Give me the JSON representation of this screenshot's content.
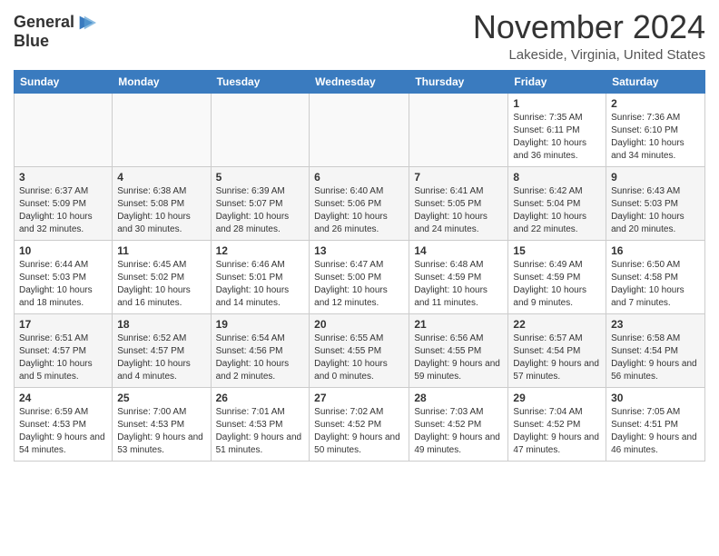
{
  "header": {
    "logo_line1": "General",
    "logo_line2": "Blue",
    "month": "November 2024",
    "location": "Lakeside, Virginia, United States"
  },
  "days_of_week": [
    "Sunday",
    "Monday",
    "Tuesday",
    "Wednesday",
    "Thursday",
    "Friday",
    "Saturday"
  ],
  "weeks": [
    [
      {
        "num": "",
        "detail": ""
      },
      {
        "num": "",
        "detail": ""
      },
      {
        "num": "",
        "detail": ""
      },
      {
        "num": "",
        "detail": ""
      },
      {
        "num": "",
        "detail": ""
      },
      {
        "num": "1",
        "detail": "Sunrise: 7:35 AM\nSunset: 6:11 PM\nDaylight: 10 hours\nand 36 minutes."
      },
      {
        "num": "2",
        "detail": "Sunrise: 7:36 AM\nSunset: 6:10 PM\nDaylight: 10 hours\nand 34 minutes."
      }
    ],
    [
      {
        "num": "3",
        "detail": "Sunrise: 6:37 AM\nSunset: 5:09 PM\nDaylight: 10 hours\nand 32 minutes."
      },
      {
        "num": "4",
        "detail": "Sunrise: 6:38 AM\nSunset: 5:08 PM\nDaylight: 10 hours\nand 30 minutes."
      },
      {
        "num": "5",
        "detail": "Sunrise: 6:39 AM\nSunset: 5:07 PM\nDaylight: 10 hours\nand 28 minutes."
      },
      {
        "num": "6",
        "detail": "Sunrise: 6:40 AM\nSunset: 5:06 PM\nDaylight: 10 hours\nand 26 minutes."
      },
      {
        "num": "7",
        "detail": "Sunrise: 6:41 AM\nSunset: 5:05 PM\nDaylight: 10 hours\nand 24 minutes."
      },
      {
        "num": "8",
        "detail": "Sunrise: 6:42 AM\nSunset: 5:04 PM\nDaylight: 10 hours\nand 22 minutes."
      },
      {
        "num": "9",
        "detail": "Sunrise: 6:43 AM\nSunset: 5:03 PM\nDaylight: 10 hours\nand 20 minutes."
      }
    ],
    [
      {
        "num": "10",
        "detail": "Sunrise: 6:44 AM\nSunset: 5:03 PM\nDaylight: 10 hours\nand 18 minutes."
      },
      {
        "num": "11",
        "detail": "Sunrise: 6:45 AM\nSunset: 5:02 PM\nDaylight: 10 hours\nand 16 minutes."
      },
      {
        "num": "12",
        "detail": "Sunrise: 6:46 AM\nSunset: 5:01 PM\nDaylight: 10 hours\nand 14 minutes."
      },
      {
        "num": "13",
        "detail": "Sunrise: 6:47 AM\nSunset: 5:00 PM\nDaylight: 10 hours\nand 12 minutes."
      },
      {
        "num": "14",
        "detail": "Sunrise: 6:48 AM\nSunset: 4:59 PM\nDaylight: 10 hours\nand 11 minutes."
      },
      {
        "num": "15",
        "detail": "Sunrise: 6:49 AM\nSunset: 4:59 PM\nDaylight: 10 hours\nand 9 minutes."
      },
      {
        "num": "16",
        "detail": "Sunrise: 6:50 AM\nSunset: 4:58 PM\nDaylight: 10 hours\nand 7 minutes."
      }
    ],
    [
      {
        "num": "17",
        "detail": "Sunrise: 6:51 AM\nSunset: 4:57 PM\nDaylight: 10 hours\nand 5 minutes."
      },
      {
        "num": "18",
        "detail": "Sunrise: 6:52 AM\nSunset: 4:57 PM\nDaylight: 10 hours\nand 4 minutes."
      },
      {
        "num": "19",
        "detail": "Sunrise: 6:54 AM\nSunset: 4:56 PM\nDaylight: 10 hours\nand 2 minutes."
      },
      {
        "num": "20",
        "detail": "Sunrise: 6:55 AM\nSunset: 4:55 PM\nDaylight: 10 hours\nand 0 minutes."
      },
      {
        "num": "21",
        "detail": "Sunrise: 6:56 AM\nSunset: 4:55 PM\nDaylight: 9 hours\nand 59 minutes."
      },
      {
        "num": "22",
        "detail": "Sunrise: 6:57 AM\nSunset: 4:54 PM\nDaylight: 9 hours\nand 57 minutes."
      },
      {
        "num": "23",
        "detail": "Sunrise: 6:58 AM\nSunset: 4:54 PM\nDaylight: 9 hours\nand 56 minutes."
      }
    ],
    [
      {
        "num": "24",
        "detail": "Sunrise: 6:59 AM\nSunset: 4:53 PM\nDaylight: 9 hours\nand 54 minutes."
      },
      {
        "num": "25",
        "detail": "Sunrise: 7:00 AM\nSunset: 4:53 PM\nDaylight: 9 hours\nand 53 minutes."
      },
      {
        "num": "26",
        "detail": "Sunrise: 7:01 AM\nSunset: 4:53 PM\nDaylight: 9 hours\nand 51 minutes."
      },
      {
        "num": "27",
        "detail": "Sunrise: 7:02 AM\nSunset: 4:52 PM\nDaylight: 9 hours\nand 50 minutes."
      },
      {
        "num": "28",
        "detail": "Sunrise: 7:03 AM\nSunset: 4:52 PM\nDaylight: 9 hours\nand 49 minutes."
      },
      {
        "num": "29",
        "detail": "Sunrise: 7:04 AM\nSunset: 4:52 PM\nDaylight: 9 hours\nand 47 minutes."
      },
      {
        "num": "30",
        "detail": "Sunrise: 7:05 AM\nSunset: 4:51 PM\nDaylight: 9 hours\nand 46 minutes."
      }
    ]
  ]
}
